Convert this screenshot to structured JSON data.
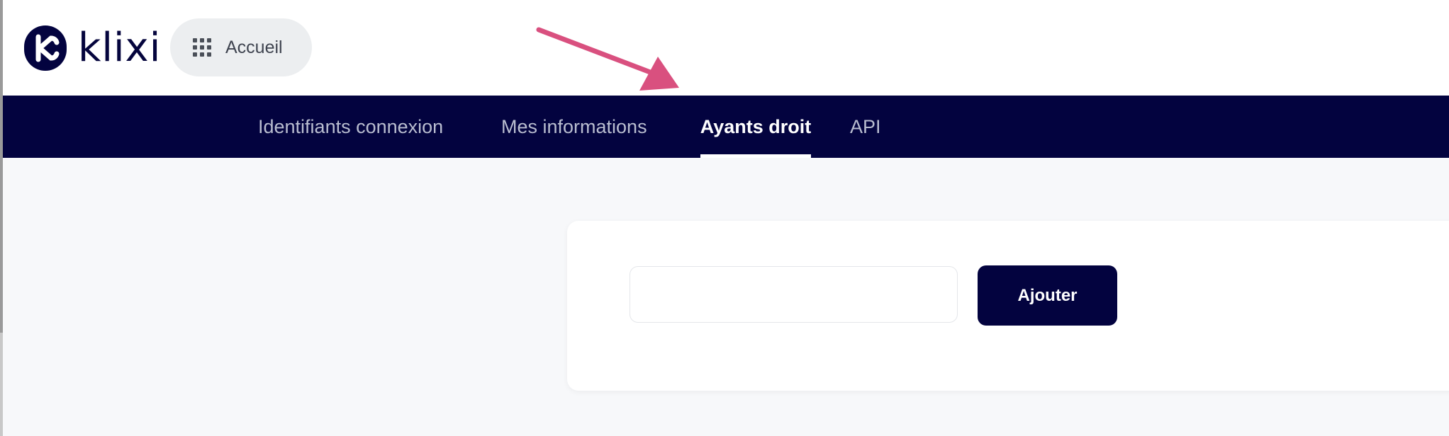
{
  "brand": {
    "name": "klixi",
    "color": "#03033f"
  },
  "header": {
    "home_label": "Accueil",
    "home_icon": "grid-icon"
  },
  "nav": {
    "tabs": [
      {
        "label": "Identifiants connexion",
        "active": false
      },
      {
        "label": "Mes informations",
        "active": false
      },
      {
        "label": "Ayants droit",
        "active": true
      },
      {
        "label": "API",
        "active": false
      }
    ]
  },
  "form": {
    "input_value": "",
    "add_label": "Ajouter"
  },
  "annotation": {
    "arrow_color": "#d9507f"
  }
}
